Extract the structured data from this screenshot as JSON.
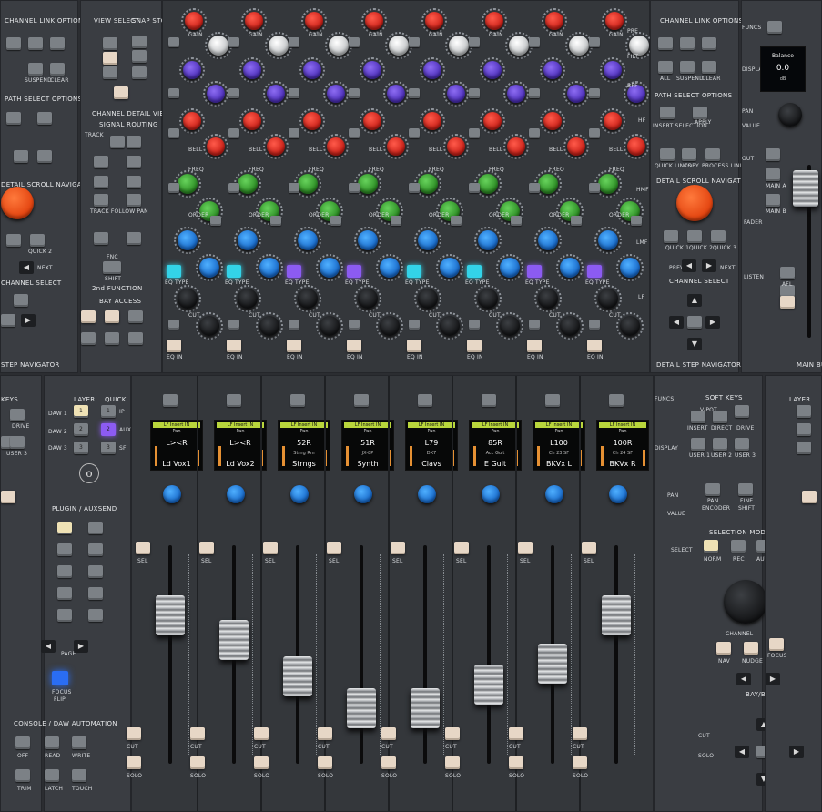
{
  "left_panel": {
    "channel_link": "CHANNEL LINK OPTIONS",
    "path_select": "PATH SELECT OPTIONS",
    "detail_scroll": "DETAIL SCROLL NAVIGATOR",
    "next": "NEXT",
    "quick": "QUICK 2",
    "channel_select": "CHANNEL SELECT",
    "step_navigator": "STEP NAVIGATOR",
    "keys": "KEYS",
    "drive": "DRIVE",
    "user": "USER 3",
    "user_2": "USER 2",
    "user_3": "USER 3",
    "suspend": "SUSPEND",
    "clear": "CLEAR"
  },
  "view_section": {
    "view_select": "VIEW SELECT",
    "snap_store": "SNAP STORE",
    "channel_detail_view": "CHANNEL DETAIL VIEW",
    "signal_routing": "SIGNAL ROUTING",
    "track": "TRACK",
    "follow_pan": "TRACK FOLLOW PAN",
    "fnc": "FNC",
    "shift": "SHIFT",
    "second_function": "2nd FUNCTION",
    "bay_access": "BAY ACCESS",
    "one": "1",
    "two": "2",
    "three": "3"
  },
  "knob_labels": {
    "gain": "GAIN",
    "freq": "FREQ",
    "bell": "BELL",
    "order": "ORDER",
    "eq_type": "EQ TYPE",
    "eq_in": "EQ IN",
    "cut": "CUT",
    "pan_trim": "PAN TRIM",
    "filt": "FILT",
    "pre": "PRE",
    "bpf": "BPF",
    "lf": "LF",
    "lmf": "LMF",
    "hmf": "HMF",
    "hf": "HF"
  },
  "right_panel": {
    "channel_link": "CHANNEL LINK OPTIONS",
    "all": "ALL",
    "suspend": "SUSPEND",
    "clear": "CLEAR",
    "path_select": "PATH SELECT OPTIONS",
    "insert_selection": "INSERT SELECTION",
    "apply": "APPLY",
    "quick_links": "QUICK LINKS",
    "copy": "COPY",
    "process_links": "PROCESS LINKS",
    "detail_scroll": "DETAIL SCROLL NAVIGATOR",
    "quick_1": "QUICK 1",
    "quick_2": "QUICK 2",
    "quick_3": "QUICK 3",
    "prev": "PREV",
    "next": "NEXT",
    "channel_select": "CHANNEL SELECT",
    "detail_step": "DETAIL STEP NAVIGATOR",
    "funcs": "FUNCS",
    "display": "DISPLAY",
    "pan": "PAN",
    "value": "VALUE",
    "out": "OUT",
    "main_a": "MAIN A",
    "main_b": "MAIN B",
    "fader": "FADER",
    "listen": "LISTEN",
    "afl": "AFL",
    "main_bus": "MAIN BUS",
    "display_title": "Balance",
    "display_value": "0.0",
    "display_unit": "dB"
  },
  "lower_left": {
    "layer": "LAYER",
    "quick": "QUICK",
    "daw1": "DAW 1",
    "daw2": "DAW 2",
    "daw3": "DAW 3",
    "layer_1": "1",
    "layer_2": "2",
    "layer_3": "3",
    "quick_1": "1",
    "quick_2": "2",
    "quick_3": "3",
    "ip": "IP",
    "aux": "AUX",
    "sf": "SF",
    "plugin_auxsend": "PLUGIN / AUXSEND",
    "page": "PAGE",
    "focus": "FOCUS",
    "flip": "FLIP",
    "automation": "CONSOLE / DAW AUTOMATION",
    "off": "OFF",
    "read": "READ",
    "write": "WRITE",
    "trim": "TRIM",
    "latch": "LATCH",
    "touch": "TOUCH"
  },
  "lower_right": {
    "funcs": "FUNCS",
    "display": "DISPLAY",
    "pan": "PAN",
    "value": "VALUE",
    "select": "SELECT",
    "cut": "CUT",
    "solo": "SOLO",
    "soft_keys": "SOFT KEYS",
    "v_pot": "V-POT",
    "insert": "INSERT",
    "direct": "DIRECT",
    "drive": "DRIVE",
    "user_1": "USER 1",
    "user_2": "USER 2",
    "user_3": "USER 3",
    "pan_btn": "PAN",
    "fine": "FINE",
    "encoder": "ENCODER",
    "shift": "SHIFT",
    "selection_mode": "SELECTION MODE",
    "norm": "NORM",
    "rec": "REC",
    "auto": "AUTO",
    "channel": "CHANNEL",
    "nav": "NAV",
    "nudge": "NUDGE",
    "focus": "FOCUS",
    "bay_bank": "BAY/BANK",
    "layer": "LAYER"
  },
  "strip_labels": {
    "sel": "SEL",
    "cut": "CUT",
    "solo": "SOLO"
  },
  "channels": [
    {
      "insert": "LF Insert IN",
      "pan": "Pan",
      "value": "L><R",
      "sub": "",
      "name": "Ld Vox1"
    },
    {
      "insert": "LF Insert IN",
      "pan": "Pan",
      "value": "L><R",
      "sub": "",
      "name": "Ld Vox2"
    },
    {
      "insert": "LF Insert IN",
      "pan": "Pan",
      "value": "52R",
      "sub": "Strng Rm",
      "name": "Strngs"
    },
    {
      "insert": "LF Insert IN",
      "pan": "Pan",
      "value": "51R",
      "sub": "JX-8P",
      "name": "Synth"
    },
    {
      "insert": "LF Insert IN",
      "pan": "Pan",
      "value": "L79",
      "sub": "DX7",
      "name": "Clavs"
    },
    {
      "insert": "LF Insert IN",
      "pan": "Pan",
      "value": "85R",
      "sub": "Acc Guit",
      "name": "E Guit"
    },
    {
      "insert": "LF Insert IN",
      "pan": "Pan",
      "value": "L100",
      "sub": "Ch 23 SF",
      "name": "BKVx L"
    },
    {
      "insert": "LF Insert IN",
      "pan": "Pan",
      "value": "100R",
      "sub": "Ch 24 SF",
      "name": "BKVx R"
    }
  ],
  "fader_levels": [
    0.72,
    0.58,
    0.38,
    0.2,
    0.2,
    0.33,
    0.45,
    0.72
  ],
  "colors": {
    "panel": "#3a3d42",
    "screen_insert": "#b9d63c",
    "knob_red": "#d72a20",
    "knob_purple": "#5b3ad0",
    "knob_green": "#3aa830",
    "knob_blue": "#1f7ad8",
    "knob_orange": "#ee5520",
    "eq_cyan": "#33d3e8",
    "eq_violet": "#8c5bf2",
    "focus_blue": "#2a6df3"
  }
}
